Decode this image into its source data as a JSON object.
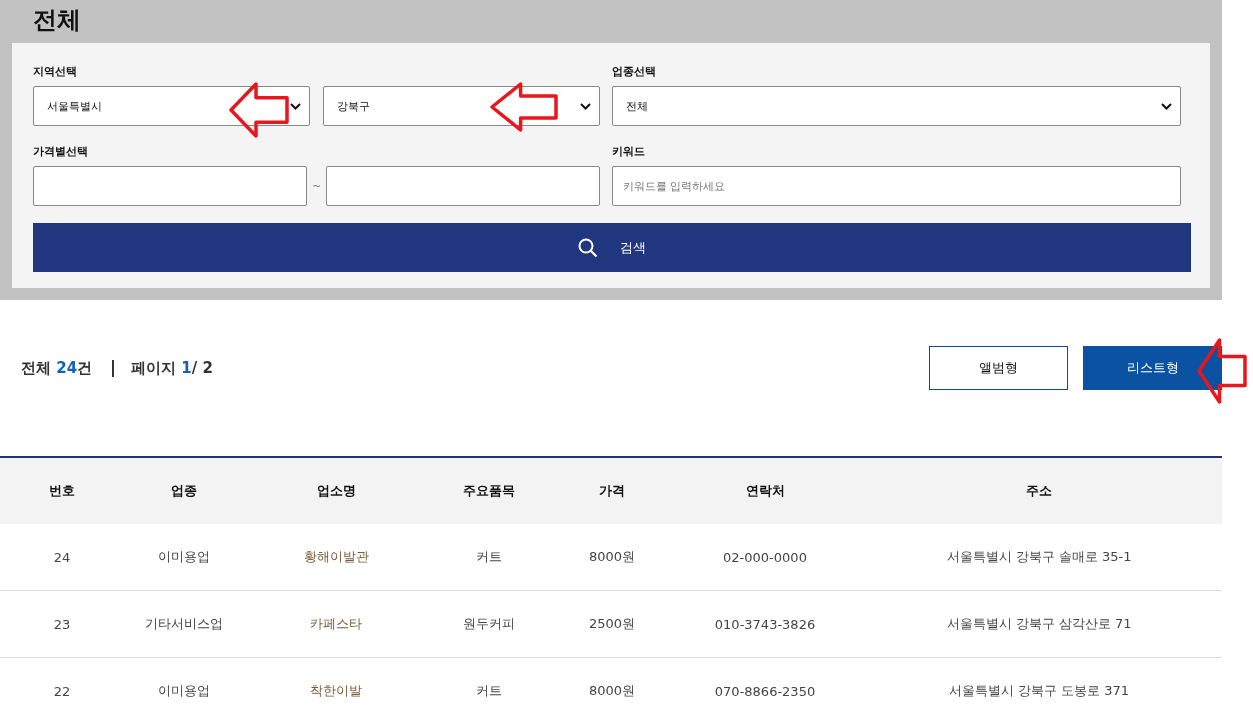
{
  "title": "전체",
  "filters": {
    "region_label": "지역선택",
    "region_selects": [
      {
        "value": "서울특별시"
      },
      {
        "value": "강북구"
      }
    ],
    "category_label": "업종선택",
    "category_select": {
      "value": "전체"
    },
    "price_label": "가격별선택",
    "price_separator": "~",
    "keyword_label": "키워드",
    "keyword_field": {
      "placeholder": "키워드를 입력하세요"
    },
    "search_button": "검색"
  },
  "summary": {
    "total_label": "전체",
    "total_count": "24",
    "total_unit": "건",
    "page_label": "페이지",
    "page_current": "1",
    "page_total": "/ 2"
  },
  "view_buttons": [
    {
      "label": "앨범형",
      "selected": false
    },
    {
      "label": "리스트형",
      "selected": true
    }
  ],
  "table": {
    "columns": [
      "번호",
      "업종",
      "업소명",
      "주요품목",
      "가격",
      "연락처",
      "주소"
    ],
    "rows": [
      [
        "24",
        "이미용업",
        "황해이발관",
        "커트",
        "8000원",
        "02-000-0000",
        "서울특별시 강북구 솔매로 35-1"
      ],
      [
        "23",
        "기타서비스업",
        "카페스타",
        "원두커피",
        "2500원",
        "010-3743-3826",
        "서울특별시 강북구 삼각산로 71"
      ],
      [
        "22",
        "이미용업",
        "착한이발",
        "커트",
        "8000원",
        "070-8866-2350",
        "서울특별시 강북구 도봉로 371"
      ]
    ]
  }
}
